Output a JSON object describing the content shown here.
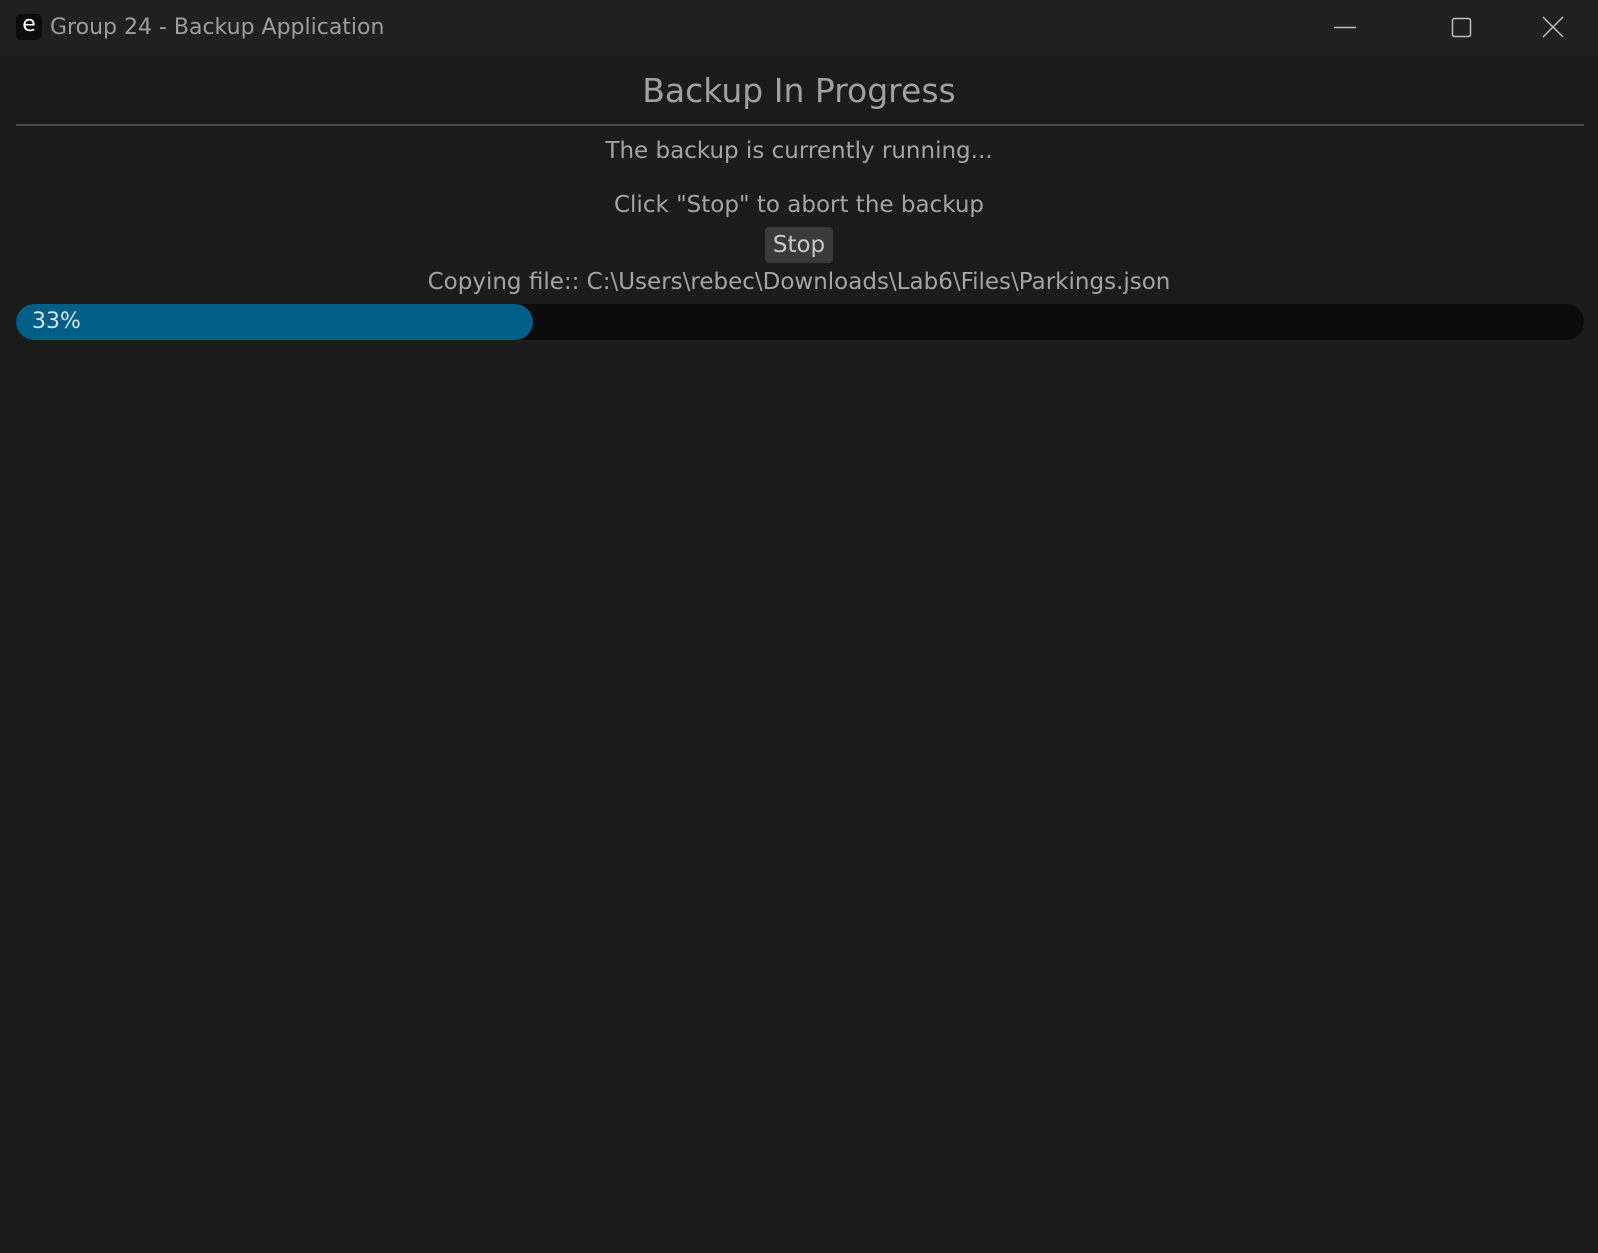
{
  "window": {
    "icon_letter": "e",
    "title": "Group 24 - Backup Application",
    "controls": {
      "minimize_icon": "minimize-icon",
      "maximize_icon": "maximize-icon",
      "close_icon": "close-icon"
    }
  },
  "main": {
    "heading": "Backup In Progress",
    "status_text": "The backup is currently running...",
    "hint_text": "Click \"Stop\" to abort the backup",
    "stop_label": "Stop",
    "file_text": "Copying file:: C:\\Users\\rebec\\Downloads\\Lab6\\Files\\Parkings.json"
  },
  "progress": {
    "percent": 33,
    "label": "33%"
  },
  "colors": {
    "background": "#1b1b1b",
    "titlebar": "#202020",
    "accent": "#005f87",
    "track": "#0b0b0b"
  }
}
